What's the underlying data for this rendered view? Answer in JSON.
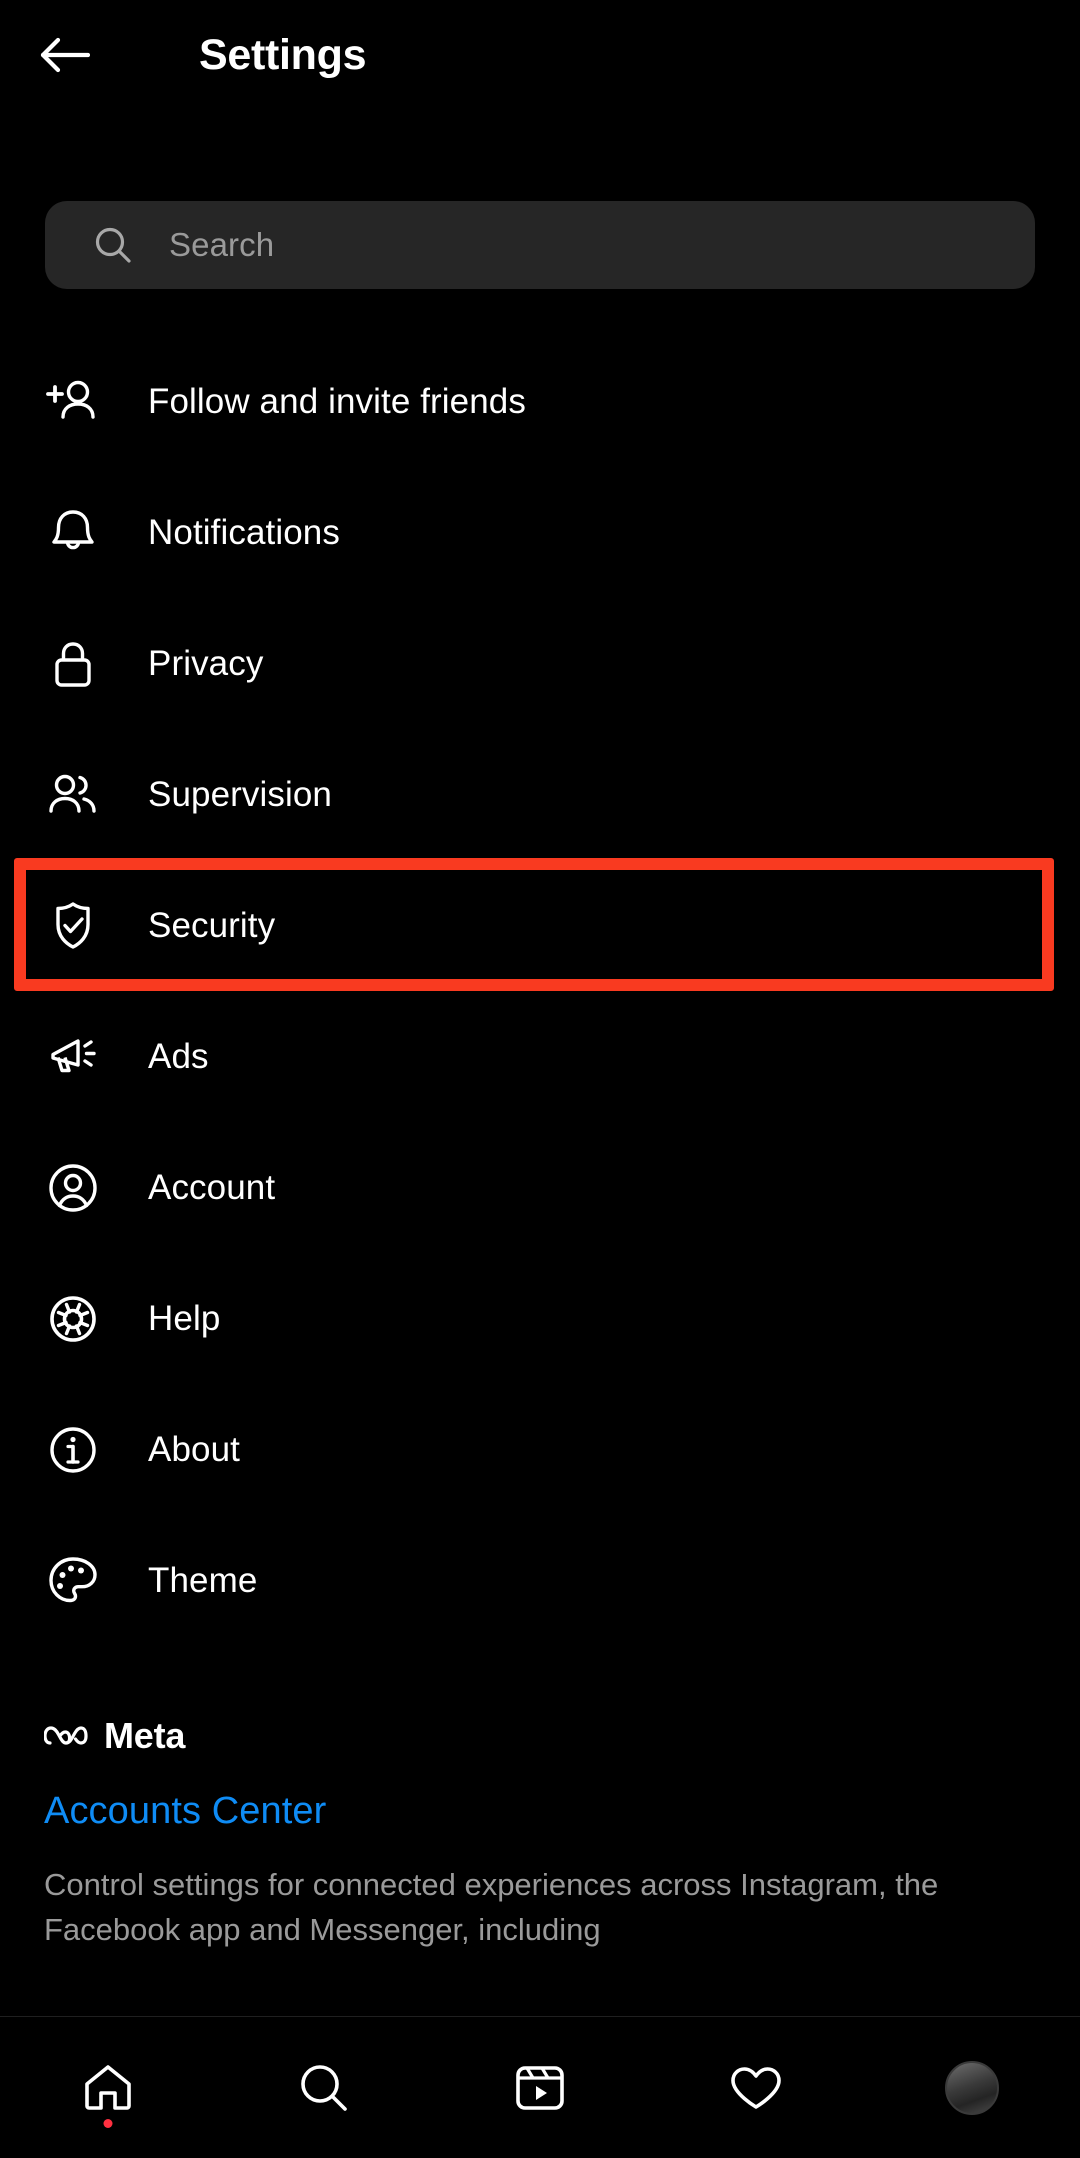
{
  "header": {
    "title": "Settings",
    "back_icon": "arrow-left-icon"
  },
  "search": {
    "placeholder": "Search",
    "icon": "search-icon",
    "value": ""
  },
  "menu": {
    "items": [
      {
        "label": "Follow and invite friends",
        "icon": "person-add-icon",
        "highlighted": false
      },
      {
        "label": "Notifications",
        "icon": "bell-icon",
        "highlighted": false
      },
      {
        "label": "Privacy",
        "icon": "lock-icon",
        "highlighted": false
      },
      {
        "label": "Supervision",
        "icon": "people-icon",
        "highlighted": false
      },
      {
        "label": "Security",
        "icon": "shield-check-icon",
        "highlighted": true
      },
      {
        "label": "Ads",
        "icon": "megaphone-icon",
        "highlighted": false
      },
      {
        "label": "Account",
        "icon": "person-circle-icon",
        "highlighted": false
      },
      {
        "label": "Help",
        "icon": "life-ring-icon",
        "highlighted": false
      },
      {
        "label": "About",
        "icon": "info-circle-icon",
        "highlighted": false
      },
      {
        "label": "Theme",
        "icon": "palette-icon",
        "highlighted": false
      }
    ]
  },
  "meta": {
    "brand_name": "Meta",
    "brand_icon": "meta-infinity-logo",
    "accounts_center_label": "Accounts Center",
    "description": "Control settings for connected experiences across Instagram, the Facebook app and Messenger, including"
  },
  "bottom_nav": {
    "items": [
      {
        "icon": "home-icon",
        "label": "Home",
        "active": true,
        "has_dot": true
      },
      {
        "icon": "search-icon",
        "label": "Search",
        "active": false,
        "has_dot": false
      },
      {
        "icon": "reels-icon",
        "label": "Reels",
        "active": false,
        "has_dot": false
      },
      {
        "icon": "heart-icon",
        "label": "Activity",
        "active": false,
        "has_dot": false
      },
      {
        "icon": "profile-avatar",
        "label": "Profile",
        "active": false,
        "has_dot": false
      }
    ]
  },
  "colors": {
    "background": "#000000",
    "text_primary": "#ffffff",
    "text_secondary": "#9a9a9a",
    "search_field": "#262626",
    "link_blue": "#0F8CF5",
    "highlight_red": "#F93A20",
    "notification_dot": "#FF3040"
  }
}
